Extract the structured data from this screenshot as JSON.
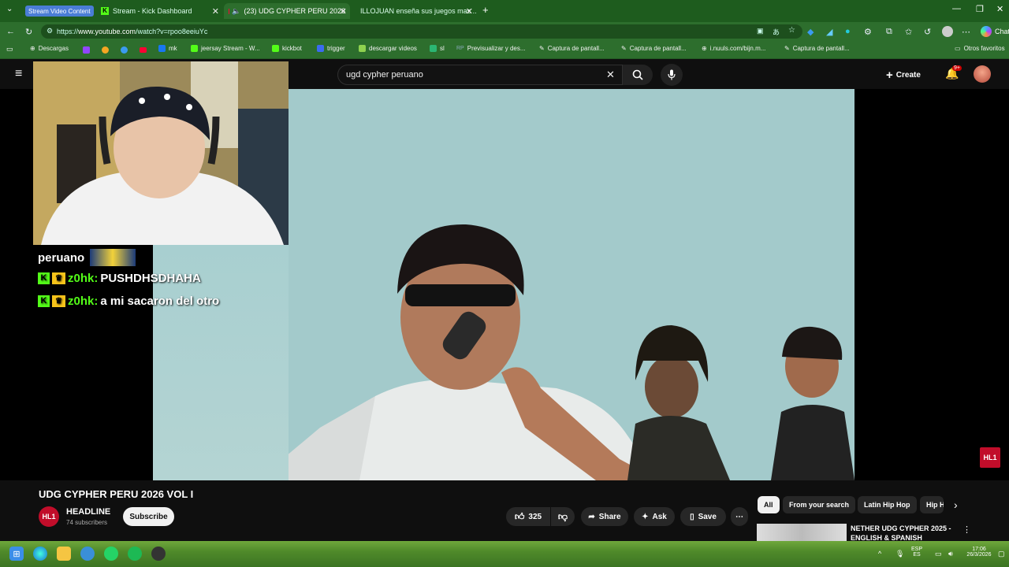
{
  "browser": {
    "tab_group_label": "Stream Video Content",
    "tabs": [
      {
        "label": "Stream - Kick Dashboard",
        "active": false
      },
      {
        "label": "(23) UDG CYPHER PERU 2026",
        "active": true
      },
      {
        "label": "ILLOJUAN enseña sus juegos mas ...",
        "active": false
      }
    ],
    "url_prefix": "https://",
    "url_host": "www.youtube.com",
    "url_path": "/watch?v=rpoo8eeiuYc",
    "bookmarks": [
      "Descargas",
      "mk",
      "jeersay Stream - W...",
      "kickbot",
      "trigger",
      "descargar videos",
      "sl",
      "Previsualizar y des...",
      "Captura de pantall...",
      "Captura de pantall...",
      "i.nuuls.com/bijn.m...",
      "Captura de pantall..."
    ],
    "other_favorites": "Otros favoritos",
    "chat_button": "Chat"
  },
  "youtube": {
    "search_value": "ugd cypher peruano",
    "create_label": "Create",
    "notif_count": "9+",
    "channel_badge": "HL1"
  },
  "stream_chat": [
    {
      "user": "",
      "message": "peruano"
    },
    {
      "user": "z0hk:",
      "message": "PUSHDHSDHAHA"
    },
    {
      "user": "z0hk:",
      "message": "a mi sacaron del otro"
    }
  ],
  "video": {
    "title": "UDG CYPHER PERU 2026 VOL I",
    "channel_name": "HEADLINE",
    "channel_avatar": "HL1",
    "subscribers": "74 subscribers",
    "subscribe_label": "Subscribe",
    "likes": "325",
    "share_label": "Share",
    "ask_label": "Ask",
    "save_label": "Save"
  },
  "chips": [
    "All",
    "From your search",
    "Latin Hip Hop",
    "Hip H"
  ],
  "recommendation": {
    "title": "NETHER UDG CYPHER 2025 - ENGLISH & SPANISH"
  },
  "taskbar": {
    "lang_top": "ESP",
    "lang_bottom": "ES",
    "time": "17:06",
    "date": "26/3/2026"
  },
  "colors": {
    "browser_green": "#2d6e2d",
    "kick_green": "#53fc18",
    "youtube_red": "#ff0033",
    "channel_red": "#c10d2a"
  }
}
